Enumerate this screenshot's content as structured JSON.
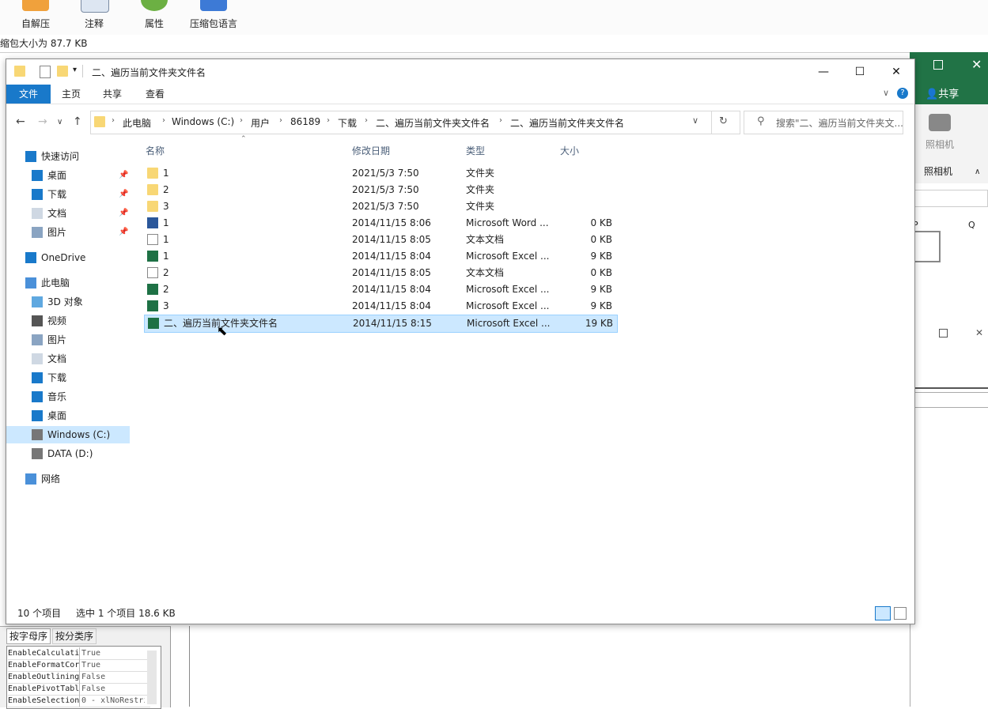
{
  "bg_app": {
    "toolbar": [
      {
        "label": "自解压",
        "icon": "self-extract-icon"
      },
      {
        "label": "注释",
        "icon": "comment-icon"
      },
      {
        "label": "属性",
        "icon": "properties-icon"
      },
      {
        "label": "压缩包语言",
        "icon": "archive-language-icon"
      }
    ],
    "status": "缩包大小为 87.7 KB"
  },
  "excel_bg": {
    "share": "共享",
    "camera": "照相机",
    "group": "照相机",
    "col_p": "P",
    "col_q": "Q"
  },
  "props_panel": {
    "tabs": [
      "按字母序",
      "按分类序"
    ],
    "rows": [
      {
        "name": "EnableCalculati",
        "value": "True"
      },
      {
        "name": "EnableFormatCor",
        "value": "True"
      },
      {
        "name": "EnableOutlining",
        "value": "False"
      },
      {
        "name": "EnablePivotTabl",
        "value": "False"
      },
      {
        "name": "EnableSelection",
        "value": "0 - xlNoRestri"
      }
    ]
  },
  "explorer": {
    "title": "二、遍历当前文件夹文件名",
    "tabs": [
      "文件",
      "主页",
      "共享",
      "查看"
    ],
    "breadcrumbs": [
      "此电脑",
      "Windows (C:)",
      "用户",
      "86189",
      "下载",
      "二、遍历当前文件夹文件名",
      "二、遍历当前文件夹文件名"
    ],
    "search_placeholder": "搜索\"二、遍历当前文件夹文...",
    "nav": [
      {
        "label": "快速访问",
        "icon": "star-icon",
        "indent": 0,
        "pinned": false
      },
      {
        "label": "桌面",
        "icon": "desktop-icon",
        "indent": 1,
        "pinned": true
      },
      {
        "label": "下载",
        "icon": "download-icon",
        "indent": 1,
        "pinned": true
      },
      {
        "label": "文档",
        "icon": "document-icon",
        "indent": 1,
        "pinned": true
      },
      {
        "label": "图片",
        "icon": "picture-icon",
        "indent": 1,
        "pinned": true
      },
      {
        "label": "OneDrive",
        "icon": "cloud-icon",
        "indent": 0,
        "pinned": false
      },
      {
        "label": "此电脑",
        "icon": "computer-icon",
        "indent": 0,
        "pinned": false
      },
      {
        "label": "3D 对象",
        "icon": "cube-icon",
        "indent": 1,
        "pinned": false
      },
      {
        "label": "视频",
        "icon": "video-icon",
        "indent": 1,
        "pinned": false
      },
      {
        "label": "图片",
        "icon": "picture-icon",
        "indent": 1,
        "pinned": false
      },
      {
        "label": "文档",
        "icon": "document-icon",
        "indent": 1,
        "pinned": false
      },
      {
        "label": "下载",
        "icon": "download-icon",
        "indent": 1,
        "pinned": false
      },
      {
        "label": "音乐",
        "icon": "music-icon",
        "indent": 1,
        "pinned": false
      },
      {
        "label": "桌面",
        "icon": "desktop-icon",
        "indent": 1,
        "pinned": false
      },
      {
        "label": "Windows (C:)",
        "icon": "drive-icon",
        "indent": 1,
        "pinned": false,
        "selected": true
      },
      {
        "label": "DATA (D:)",
        "icon": "drive-icon",
        "indent": 1,
        "pinned": false
      },
      {
        "label": "网络",
        "icon": "network-icon",
        "indent": 0,
        "pinned": false
      }
    ],
    "columns": [
      "名称",
      "修改日期",
      "类型",
      "大小"
    ],
    "files": [
      {
        "name": "1",
        "date": "2021/5/3 7:50",
        "type": "文件夹",
        "size": "",
        "kind": "folder"
      },
      {
        "name": "2",
        "date": "2021/5/3 7:50",
        "type": "文件夹",
        "size": "",
        "kind": "folder"
      },
      {
        "name": "3",
        "date": "2021/5/3 7:50",
        "type": "文件夹",
        "size": "",
        "kind": "folder"
      },
      {
        "name": "1",
        "date": "2014/11/15 8:06",
        "type": "Microsoft Word ...",
        "size": "0 KB",
        "kind": "word"
      },
      {
        "name": "1",
        "date": "2014/11/15 8:05",
        "type": "文本文档",
        "size": "0 KB",
        "kind": "doc"
      },
      {
        "name": "1",
        "date": "2014/11/15 8:04",
        "type": "Microsoft Excel ...",
        "size": "9 KB",
        "kind": "excel"
      },
      {
        "name": "2",
        "date": "2014/11/15 8:05",
        "type": "文本文档",
        "size": "0 KB",
        "kind": "doc"
      },
      {
        "name": "2",
        "date": "2014/11/15 8:04",
        "type": "Microsoft Excel ...",
        "size": "9 KB",
        "kind": "excel"
      },
      {
        "name": "3",
        "date": "2014/11/15 8:04",
        "type": "Microsoft Excel ...",
        "size": "9 KB",
        "kind": "excel"
      },
      {
        "name": "二、遍历当前文件夹文件名",
        "date": "2014/11/15 8:15",
        "type": "Microsoft Excel ...",
        "size": "19 KB",
        "kind": "excel",
        "selected": true
      }
    ],
    "status": {
      "count": "10 个项目",
      "selection": "选中 1 个项目  18.6 KB"
    }
  }
}
